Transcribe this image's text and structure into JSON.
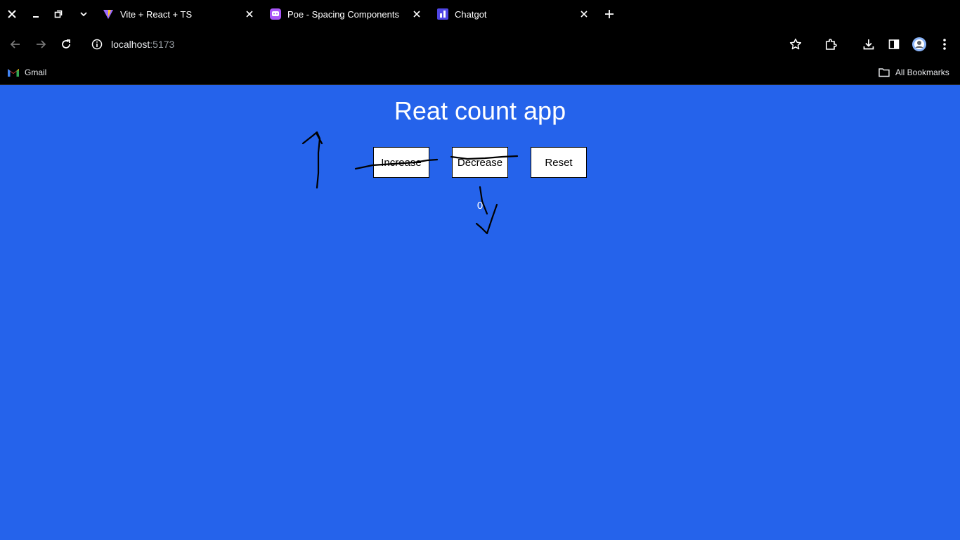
{
  "window_controls": {
    "close": "close-window",
    "minimize": "minimize-window",
    "restore": "restore-window",
    "tab_search": "tab-search"
  },
  "tabs": [
    {
      "title": "Vite + React + TS",
      "icon": "vite-icon",
      "active": false
    },
    {
      "title": "Poe - Spacing Components",
      "icon": "poe-icon",
      "active": false
    },
    {
      "title": "Chatgot",
      "icon": "chatgot-icon",
      "active": true
    }
  ],
  "new_tab": "new-tab",
  "address_bar": {
    "host": "localhost",
    "port": ":5173"
  },
  "bookmarks": {
    "items": [
      {
        "label": "Gmail",
        "icon": "gmail-icon"
      }
    ],
    "all_bookmarks": "All Bookmarks"
  },
  "app": {
    "title": "Reat count app",
    "buttons": {
      "increase": "Increase",
      "decrease": "Decrease",
      "reset": "Reset"
    },
    "count": "0"
  },
  "colors": {
    "page_background": "#2563eb",
    "chrome_background": "#000000",
    "button_background": "#ffffff",
    "annotation_ink": "#000000"
  }
}
